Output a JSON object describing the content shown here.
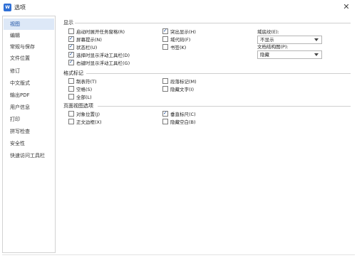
{
  "window": {
    "title": "选项",
    "app_icon_text": "W",
    "close_icon": "close-icon"
  },
  "sidebar": {
    "items": [
      {
        "label": "视图",
        "active": true
      },
      {
        "label": "编辑"
      },
      {
        "label": "常规与保存"
      },
      {
        "label": "文件位置"
      },
      {
        "label": "修订"
      },
      {
        "label": "中文版式"
      },
      {
        "label": "输出PDF"
      },
      {
        "label": "用户信息"
      },
      {
        "label": "打印"
      },
      {
        "label": "拼写检查"
      },
      {
        "label": "安全性"
      },
      {
        "label": "快速访问工具栏"
      }
    ]
  },
  "display": {
    "title": "显示",
    "left": [
      {
        "label": "启动时展开任务窗格(R)",
        "checked": false
      },
      {
        "label": "屏幕提示(N)",
        "checked": true
      },
      {
        "label": "状态栏(U)",
        "checked": true
      },
      {
        "label": "选择时显示浮动工具栏(D)",
        "checked": true
      },
      {
        "label": "右键时显示浮动工具栏(G)",
        "checked": true
      }
    ],
    "right": [
      {
        "label": "突出显示(H)",
        "checked": true
      },
      {
        "label": "域代码(F)",
        "checked": false
      },
      {
        "label": "书签(K)",
        "checked": false
      }
    ],
    "field_shading_label": "域底纹(E):",
    "field_shading_value": "不显示",
    "doc_map_label": "文档结构图(P):",
    "doc_map_value": "隐藏"
  },
  "format_marks": {
    "title": "格式标记",
    "left": [
      {
        "label": "制表符(T)",
        "checked": false
      },
      {
        "label": "空格(S)",
        "checked": false
      },
      {
        "label": "全部(L)",
        "checked": false
      }
    ],
    "right": [
      {
        "label": "段落标记(M)",
        "checked": false
      },
      {
        "label": "隐藏文字(I)",
        "checked": false
      }
    ]
  },
  "page_view": {
    "title": "页面视图选项",
    "left": [
      {
        "label": "对象位置(J)",
        "checked": false
      },
      {
        "label": "正文边框(X)",
        "checked": false
      }
    ],
    "right": [
      {
        "label": "垂直标尺(C)",
        "checked": true
      },
      {
        "label": "隐藏空白(B)",
        "checked": false
      }
    ]
  }
}
